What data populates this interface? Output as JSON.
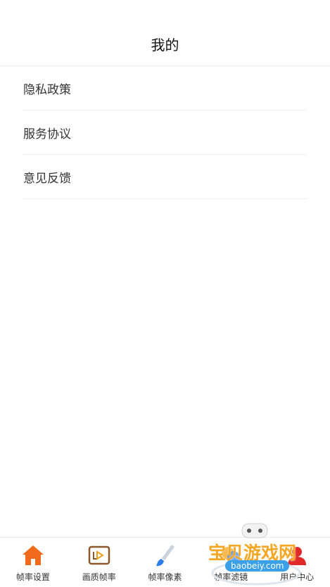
{
  "header": {
    "title": "我的"
  },
  "menu": {
    "items": [
      {
        "label": "隐私政策"
      },
      {
        "label": "服务协议"
      },
      {
        "label": "意见反馈"
      }
    ]
  },
  "tabbar": {
    "tabs": [
      {
        "label": "帧率设置",
        "icon": "home-icon",
        "active": true
      },
      {
        "label": "画质帧率",
        "icon": "video-frame-icon"
      },
      {
        "label": "帧率像素",
        "icon": "brush-icon"
      },
      {
        "label": "帧率滤镜",
        "icon": "filter-icon"
      },
      {
        "label": "用户中心",
        "icon": "user-icon"
      }
    ]
  },
  "watermark": {
    "text": "宝贝游戏网",
    "url": "baobeiy.com"
  },
  "colors": {
    "accent": "#f26b1d",
    "brown": "#8b5a2b",
    "blue": "#2f7fe8",
    "red": "#e02a2a"
  }
}
